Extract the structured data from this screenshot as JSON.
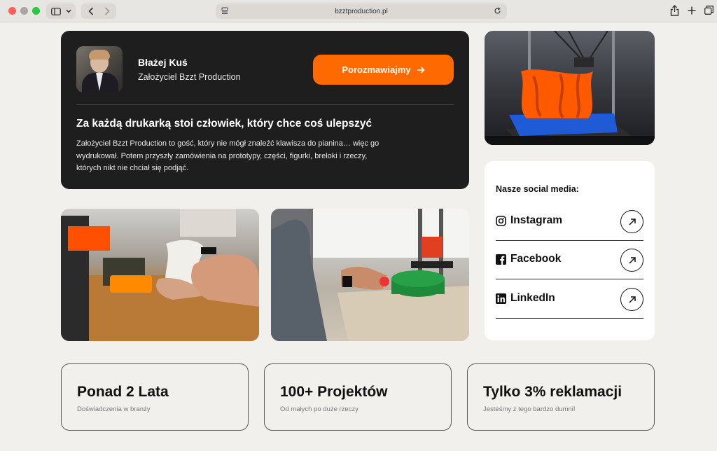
{
  "browser": {
    "url": "bzztproduction.pl",
    "icons": [
      "sidebar-icon",
      "chevron-down-icon",
      "back-icon",
      "forward-icon",
      "reader-icon",
      "reload-icon",
      "share-icon",
      "new-tab-icon",
      "tabs-overview-icon"
    ]
  },
  "profile": {
    "name": "Błażej Kuś",
    "role": "Założyciel Bzzt Production",
    "cta_label": "Porozmawiajmy",
    "cta_icon": "arrow-right-icon",
    "headline": "Za każdą drukarką stoi człowiek, który chce coś ulepszyć",
    "bio": "Założyciel Bzzt Production to gość, który nie mógł znaleźć klawisza do pianina… więc go wydrukował. Potem przyszły zamówienia na prototypy, części, figurki, breloki i rzeczy, których nikt nie chciał się podjąć."
  },
  "social": {
    "title": "Nasze social media:",
    "items": [
      {
        "label": "Instagram",
        "icon": "instagram-icon"
      },
      {
        "label": "Facebook",
        "icon": "facebook-icon"
      },
      {
        "label": "LinkedIn",
        "icon": "linkedin-icon"
      }
    ]
  },
  "stats": [
    {
      "value": "Ponad 2 Lata",
      "sub": "Doświadczenia w branży"
    },
    {
      "value": "100+ Projektów",
      "sub": "Od małych po duże rzeczy"
    },
    {
      "value": "Tylko 3% reklamacji",
      "sub": "Jesteśmy z tego bardzo dumni!"
    }
  ],
  "colors": {
    "accent": "#ff6a00",
    "dark_card": "#1e1e1e",
    "page_bg": "#f2f0ed"
  }
}
